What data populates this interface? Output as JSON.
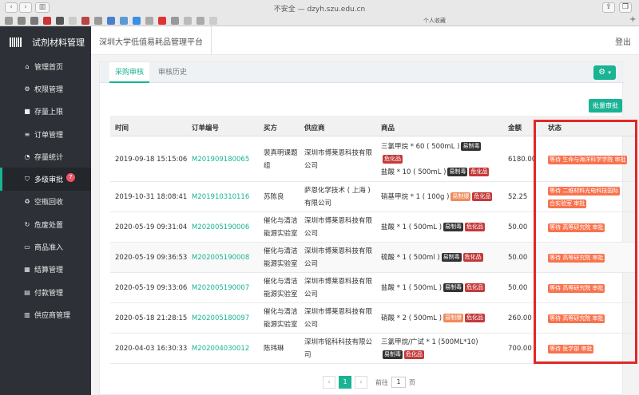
{
  "browser": {
    "url": "不安全 — dzyh.szu.edu.cn",
    "bookmarks_label": "个人收藏"
  },
  "sidebar": {
    "brand": "试剂材料管理",
    "items": [
      {
        "label": "管理首页",
        "icon": "home-icon",
        "glyph": "⌂"
      },
      {
        "label": "权限管理",
        "icon": "gears-icon",
        "glyph": "⚙"
      },
      {
        "label": "存量上限",
        "icon": "square-icon",
        "glyph": "■"
      },
      {
        "label": "订单管理",
        "icon": "list-icon",
        "glyph": "≡"
      },
      {
        "label": "存量统计",
        "icon": "pie-chart-icon",
        "glyph": "◔"
      },
      {
        "label": "多级审批",
        "icon": "shield-icon",
        "glyph": "⛉",
        "badge": "7"
      },
      {
        "label": "空瓶回收",
        "icon": "recycle-icon",
        "glyph": "♻"
      },
      {
        "label": "危废处置",
        "icon": "refresh-icon",
        "glyph": "↻"
      },
      {
        "label": "商品准入",
        "icon": "folder-icon",
        "glyph": "▭"
      },
      {
        "label": "结算管理",
        "icon": "table-icon",
        "glyph": "▦"
      },
      {
        "label": "付款管理",
        "icon": "file-icon",
        "glyph": "▤"
      },
      {
        "label": "供应商管理",
        "icon": "book-icon",
        "glyph": "▥"
      }
    ]
  },
  "header": {
    "title": "深圳大学低值易耗品管理平台",
    "logout": "登出"
  },
  "tabs": [
    "采购审核",
    "审核历史"
  ],
  "batch_button": "批量审批",
  "table": {
    "columns": [
      "时间",
      "订单编号",
      "买方",
      "供应商",
      "商品",
      "金额",
      "状态"
    ],
    "rows": [
      {
        "time": "2019-09-18 15:15:06",
        "order": "M201909180065",
        "buyer": [
          "裴真明课题",
          "组"
        ],
        "supplier": [
          "深圳市博莱恩科技有限",
          "公司"
        ],
        "products": [
          {
            "name": "三氯甲烷 * 60 ( 500mL )",
            "tags": [
              {
                "t": "易制毒",
                "c": "dark"
              }
            ]
          },
          {
            "name": "",
            "tags": [
              {
                "t": "危化品",
                "c": "red"
              }
            ]
          },
          {
            "name": "盐酸 * 10 ( 500mL )",
            "tags": [
              {
                "t": "易制毒",
                "c": "dark"
              },
              {
                "t": "危化品",
                "c": "red"
              }
            ]
          }
        ],
        "amount": "6180.00",
        "status": "等待 生命与海洋科学学院 审批"
      },
      {
        "time": "2019-10-31 18:08:41",
        "order": "M201910310116",
        "buyer": [
          "苏陈良"
        ],
        "supplier": [
          "萨恩化学技术 ( 上海 )",
          "有限公司"
        ],
        "products": [
          {
            "name": "硝基甲烷 * 1 ( 100g )",
            "tags": [
              {
                "t": "易制爆",
                "c": "orange"
              },
              {
                "t": "危化品",
                "c": "red"
              }
            ]
          }
        ],
        "amount": "52.25",
        "status": "等待 二维材料光电科技国际",
        "status2": "合实验室 审批"
      },
      {
        "time": "2020-05-19 09:31:04",
        "order": "M202005190006",
        "buyer": [
          "催化与清洁",
          "能源实验室"
        ],
        "supplier": [
          "深圳市博莱恩科技有限",
          "公司"
        ],
        "products": [
          {
            "name": "盐酸 * 1 ( 500mL )",
            "tags": [
              {
                "t": "易制毒",
                "c": "dark"
              },
              {
                "t": "危化品",
                "c": "red"
              }
            ]
          }
        ],
        "amount": "50.00",
        "status": "等待 高等研究院 审批"
      },
      {
        "time": "2020-05-19 09:36:53",
        "order": "M202005190008",
        "buyer": [
          "催化与清洁",
          "能源实验室"
        ],
        "supplier": [
          "深圳市博莱恩科技有限",
          "公司"
        ],
        "products": [
          {
            "name": "硫酸 * 1 ( 500ml )",
            "tags": [
              {
                "t": "易制毒",
                "c": "dark"
              },
              {
                "t": "危化品",
                "c": "red"
              }
            ]
          }
        ],
        "amount": "50.00",
        "status": "等待 高等研究院 审批"
      },
      {
        "time": "2020-05-19 09:33:06",
        "order": "M202005190007",
        "buyer": [
          "催化与清洁",
          "能源实验室"
        ],
        "supplier": [
          "深圳市博莱恩科技有限",
          "公司"
        ],
        "products": [
          {
            "name": "盐酸 * 1 ( 500mL )",
            "tags": [
              {
                "t": "易制毒",
                "c": "dark"
              },
              {
                "t": "危化品",
                "c": "red"
              }
            ]
          }
        ],
        "amount": "50.00",
        "status": "等待 高等研究院 审批"
      },
      {
        "time": "2020-05-18 21:28:15",
        "order": "M202005180097",
        "buyer": [
          "催化与清洁",
          "能源实验室"
        ],
        "supplier": [
          "深圳市博莱恩科技有限",
          "公司"
        ],
        "products": [
          {
            "name": "硝酸 * 2 ( 500mL )",
            "tags": [
              {
                "t": "易制爆",
                "c": "orange"
              },
              {
                "t": "危化品",
                "c": "red"
              }
            ]
          }
        ],
        "amount": "260.00",
        "status": "等待 高等研究院 审批"
      },
      {
        "time": "2020-04-03 16:30:33",
        "order": "M202004030012",
        "buyer": [
          "陈玮琳"
        ],
        "supplier": [
          "深圳市铭科科技有限公",
          "司"
        ],
        "products": [
          {
            "name": "三氯甲烷/广试 * 1 (500ML*10)",
            "tags": []
          },
          {
            "name": "",
            "tags": [
              {
                "t": "易制毒",
                "c": "dark"
              },
              {
                "t": "危化品",
                "c": "red"
              }
            ]
          }
        ],
        "amount": "700.00",
        "status": "等待 医学部 审批"
      }
    ]
  },
  "pager": {
    "prev": "‹",
    "current": "1",
    "next": "›",
    "goto_label": "前往",
    "goto_value": "1",
    "page_unit": "页"
  },
  "colors": {
    "accent": "#1ab394",
    "sidebar": "#2d3036",
    "highlight_box": "#e02828"
  }
}
